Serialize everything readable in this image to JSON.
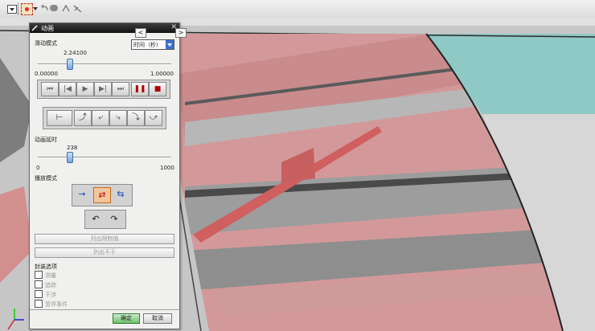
{
  "colors": {
    "panel_bg": "#f0f0ee",
    "title_bg": "#1a1a1a",
    "model_pink": "#d3999a",
    "model_gray": "#8e8e8e",
    "teal": "#8fc9c5",
    "ok_green": "#6cc26c"
  },
  "toolbar": {
    "icons": [
      "dropdown-arrow-icon",
      "selection-filter-icon",
      "undo-arrow-icon",
      "blob-icon",
      "rotate-icon",
      "sweep-icon"
    ]
  },
  "dialog": {
    "title": "动画",
    "title_icon": "wand-icon",
    "close_glyph": "✕",
    "mini_nav": {
      "prev": "<",
      "next": ">"
    },
    "slide_mode": {
      "label": "滑动模式",
      "value": "时间（秒）",
      "fraction": 0.241
    },
    "time_slider": {
      "current": "2.24100",
      "min": "0.00000",
      "max": "1.00000"
    },
    "playback": {
      "buttons": [
        "⏮",
        "|◀",
        "▶",
        "▶|",
        "⏭",
        "❚❚",
        "■"
      ]
    },
    "step_buttons": [
      "⊢",
      "⤴",
      "⤶",
      "⤷",
      "⤵",
      "⤻"
    ],
    "delay": {
      "label": "动画延时",
      "value": "238",
      "min": "0",
      "max": "1000",
      "fraction": 0.238
    },
    "play_mode": {
      "label": "播放模式",
      "buttons": [
        "→",
        "⇄",
        "⇆"
      ],
      "active_index": 1
    },
    "assoc_buttons": [
      "↶",
      "↷"
    ],
    "list_button": "列出限制值",
    "list2_button": "列出不干",
    "capture": {
      "label": "封装选项",
      "options": [
        "测量",
        "追踪",
        "干涉",
        "暂停事件"
      ]
    },
    "ok": "确定",
    "cancel": "取消"
  }
}
